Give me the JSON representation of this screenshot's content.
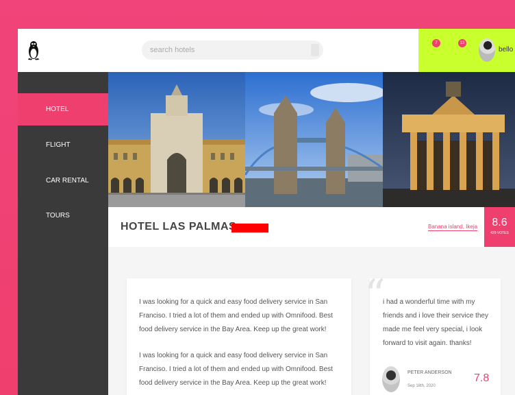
{
  "header": {
    "search_placeholder": "search hotels",
    "notifications": [
      {
        "label": "7"
      },
      {
        "label": "13"
      }
    ],
    "username": "bello"
  },
  "sidebar": {
    "items": [
      {
        "label": "HOTEL",
        "active": true
      },
      {
        "label": "FLIGHT",
        "active": false
      },
      {
        "label": "CAR RENTAL",
        "active": false
      },
      {
        "label": "TOURS",
        "active": false
      }
    ]
  },
  "hotel": {
    "name": "HOTEL LAS PALMAS",
    "location": "Banana island, Ikeja",
    "score": "8.6",
    "votes": "429 VOTES"
  },
  "description": {
    "paragraphs": [
      "I was looking for a quick and easy food delivery service in San Franciso. I tried a lot of them and ended up with Omnifood. Best food delivery service in the Bay Area. Keep up the great work!",
      "I was looking for a quick and easy food delivery service in San Franciso. I tried a lot of them and ended up with Omnifood. Best food delivery service in the Bay Area. Keep up the great work!"
    ]
  },
  "review": {
    "text": "i had a wonderful time with my friends and i love their service they made me feel very special, i look forward to visit again. thanks!",
    "reviewer": "PETER ANDERSON",
    "date": "Sep 18th, 2020",
    "score": "7.8"
  },
  "colors": {
    "accent": "#ef3f6e",
    "userbar": "#c8ff2d",
    "sidebar": "#3a3a3a",
    "red_tag": "#ff0000"
  }
}
